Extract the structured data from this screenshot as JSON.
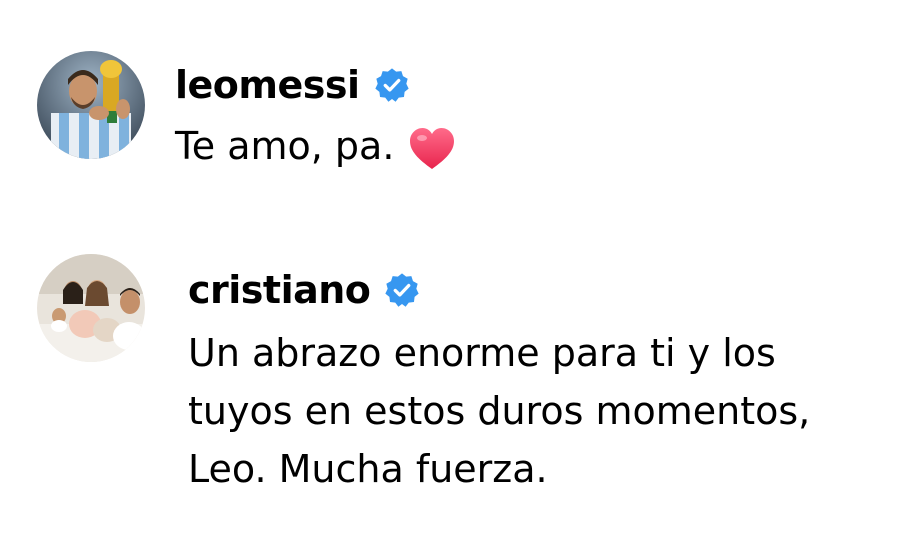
{
  "comments": [
    {
      "username": "leomessi",
      "verified": true,
      "avatar": "messi-trophy-avatar",
      "text": "Te amo, pa.",
      "emoji": "heart-icon"
    },
    {
      "username": "cristiano",
      "verified": true,
      "avatar": "family-photo-avatar",
      "text": "Un abrazo enorme para ti y los tuyos en estos duros momentos, Leo. Mucha fuerza."
    }
  ],
  "colors": {
    "verified_badge": "#3797F0",
    "heart": "#F0365A",
    "text": "#000000",
    "background": "#FFFFFF"
  }
}
